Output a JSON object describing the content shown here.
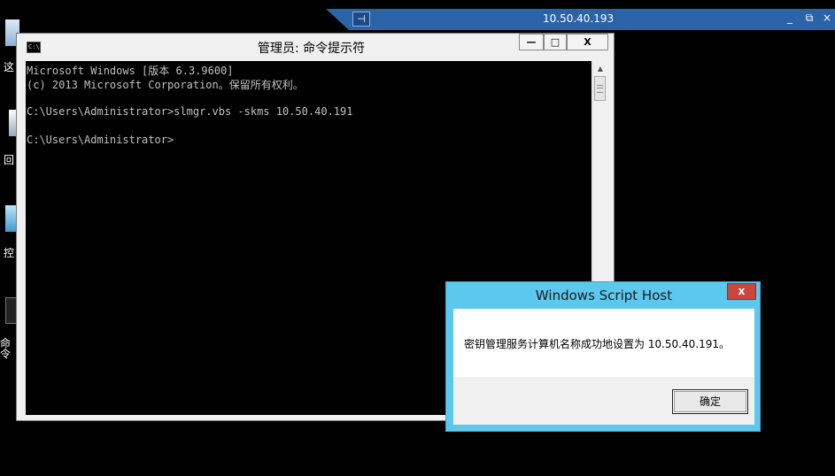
{
  "desktop": {
    "icons": [
      {
        "label": "这",
        "icon": "computer-icon"
      },
      {
        "label": "回",
        "icon": "recycle-bin-icon"
      },
      {
        "label": "控",
        "icon": "control-panel-icon"
      },
      {
        "label": "命令",
        "icon": "cmd-shortcut-icon"
      }
    ]
  },
  "rdp_bar": {
    "title": "10.50.40.193",
    "pin_glyph": "⊣",
    "minimize_glyph": "_",
    "restore_glyph": "⧉",
    "close_glyph": "×"
  },
  "cmd_window": {
    "title": "管理员: 命令提示符",
    "icon_text": "C:\\",
    "minimize_glyph": "—",
    "maximize_glyph": "□",
    "close_glyph": "X",
    "lines": [
      "Microsoft Windows [版本 6.3.9600]",
      "(c) 2013 Microsoft Corporation。保留所有权利。",
      "",
      "C:\\Users\\Administrator>slmgr.vbs -skms 10.50.40.191",
      "",
      "C:\\Users\\Administrator>"
    ]
  },
  "wsh_dialog": {
    "title": "Windows Script Host",
    "close_glyph": "x",
    "message": "密钥管理服务计算机名称成功地设置为 10.50.40.191。",
    "ok_label": "确定"
  },
  "colors": {
    "rdp_bar": "#2b63a9",
    "dialog_frame": "#5dc8ee",
    "close_red": "#c9483e"
  }
}
